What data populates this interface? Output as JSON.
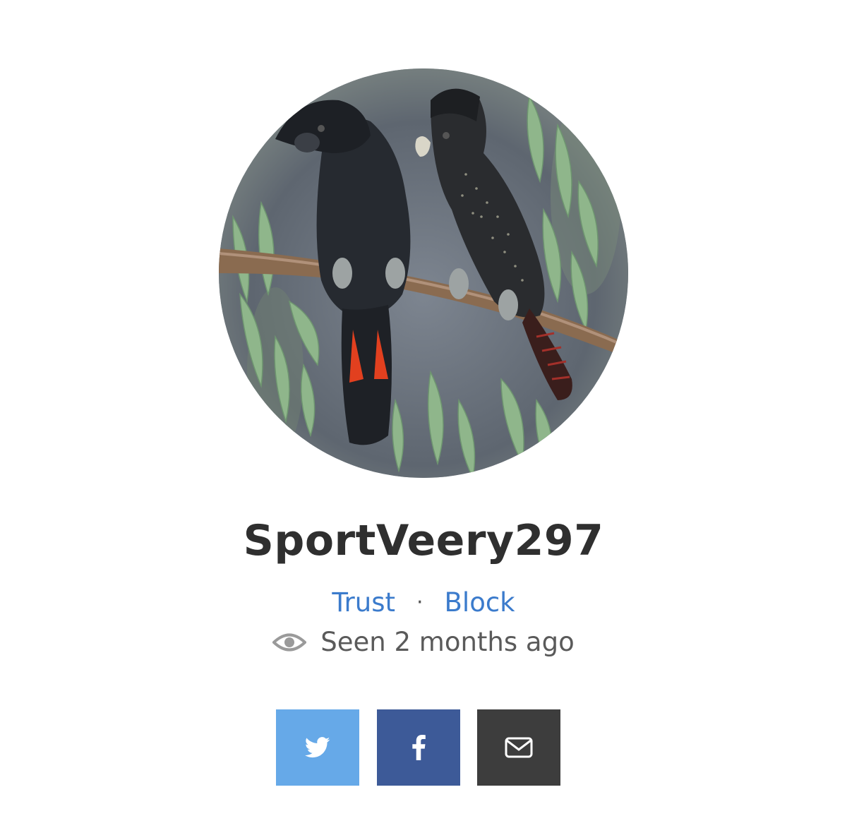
{
  "profile": {
    "username": "SportVeery297",
    "avatar_icon": "avatar-image",
    "actions": {
      "trust_label": "Trust",
      "separator": "·",
      "block_label": "Block"
    },
    "last_seen": "Seen 2 months ago",
    "last_seen_icon": "eye-icon"
  },
  "share": {
    "buttons": [
      {
        "icon": "twitter-icon",
        "color": "#66a9e8"
      },
      {
        "icon": "facebook-icon",
        "color": "#3d5a98"
      },
      {
        "icon": "email-icon",
        "color": "#3d3d3d"
      }
    ]
  },
  "colors": {
    "link": "#3b7bcc",
    "username": "#2f2f2f",
    "muted": "#5a5a5a"
  }
}
